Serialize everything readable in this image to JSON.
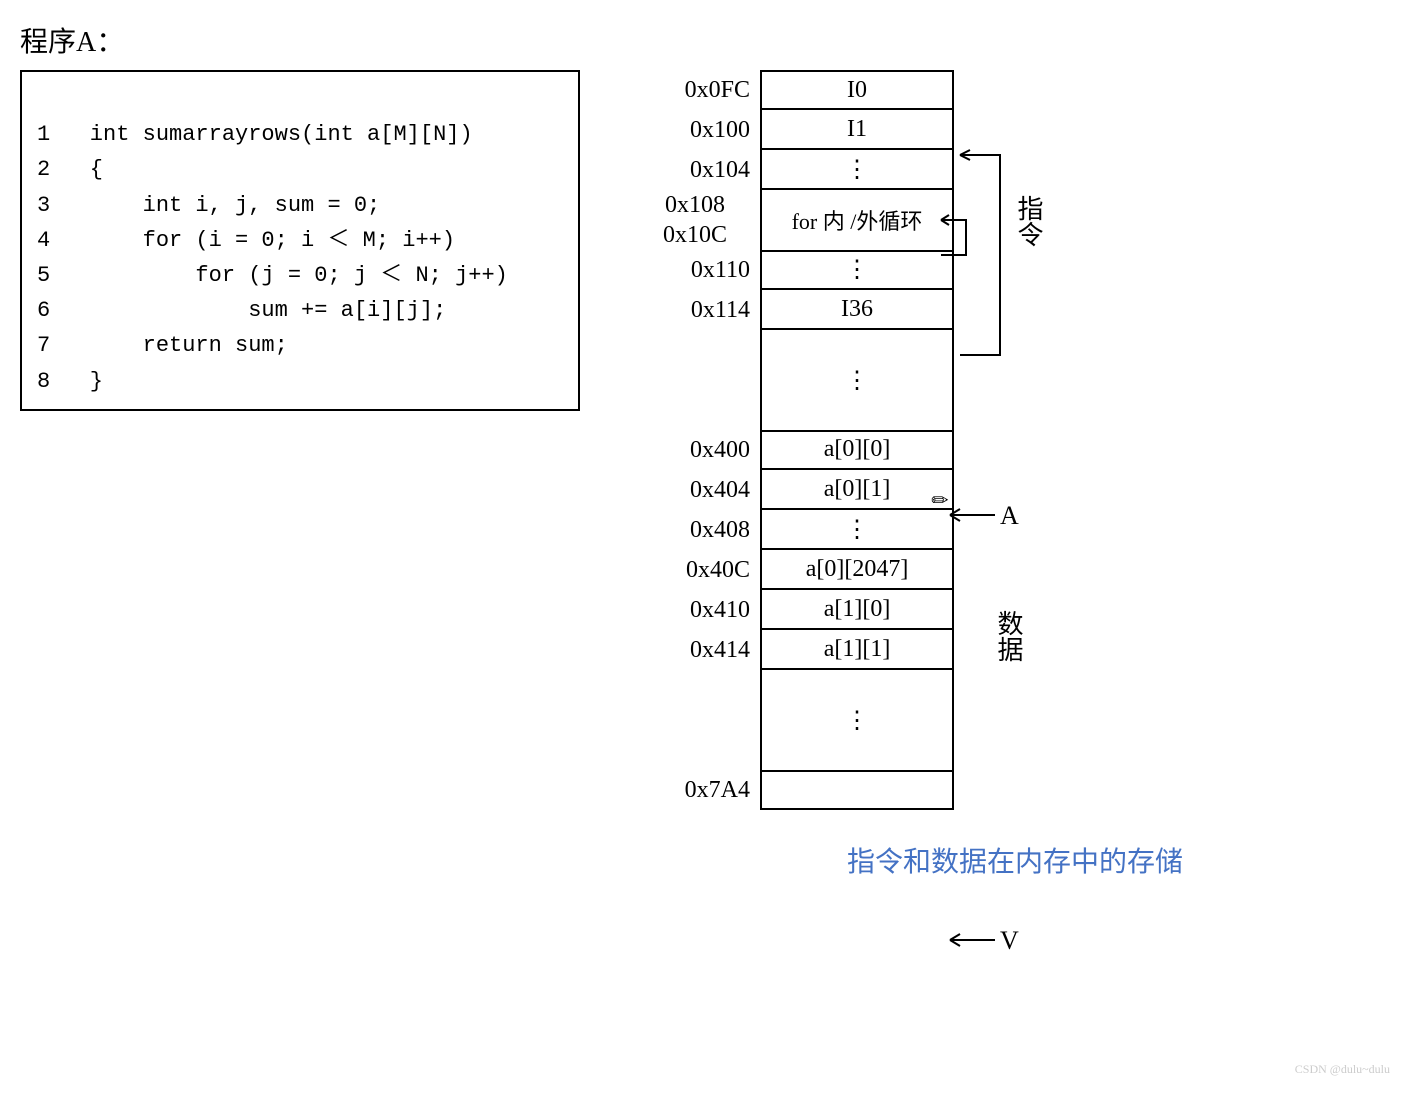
{
  "title": "程序A：",
  "code_lines": [
    "1   int sumarrayrows(int a[M][N])",
    "2   {",
    "3       int i, j, sum = 0;",
    "4       for (i = 0; i ＜ M; i++)",
    "5           for (j = 0; j ＜ N; j++)",
    "6               sum += a[i][j];",
    "7       return sum;",
    "8   }"
  ],
  "memory": {
    "rows": [
      {
        "addr": "0x0FC",
        "content": "I0"
      },
      {
        "addr": "0x100",
        "content": "I1"
      },
      {
        "addr": "0x104",
        "content": "⋮"
      },
      {
        "addr": "0x108",
        "content": "for 内 /外循环",
        "merged": true
      },
      {
        "addr": "0x10C",
        "content": ""
      },
      {
        "addr": "0x110",
        "content": "⋮"
      },
      {
        "addr": "0x114",
        "content": "I36"
      },
      {
        "addr": "",
        "content": "⋮",
        "gap": true
      },
      {
        "addr": "0x400",
        "content": "a[0][0]"
      },
      {
        "addr": "0x404",
        "content": "a[0][1]"
      },
      {
        "addr": "0x408",
        "content": "⋮"
      },
      {
        "addr": "0x40C",
        "content": "a[0][2047]"
      },
      {
        "addr": "0x410",
        "content": "a[1][0]"
      },
      {
        "addr": "0x414",
        "content": "a[1][1]"
      },
      {
        "addr": "",
        "content": "⋮",
        "gap": true
      },
      {
        "addr": "0x7A4",
        "content": ""
      }
    ],
    "labels": {
      "instructions": "指令",
      "data": "数据",
      "pointer_a": "A",
      "pointer_v": "V"
    }
  },
  "caption": "指令和数据在内存中的存储",
  "watermark": "CSDN @dulu~dulu"
}
